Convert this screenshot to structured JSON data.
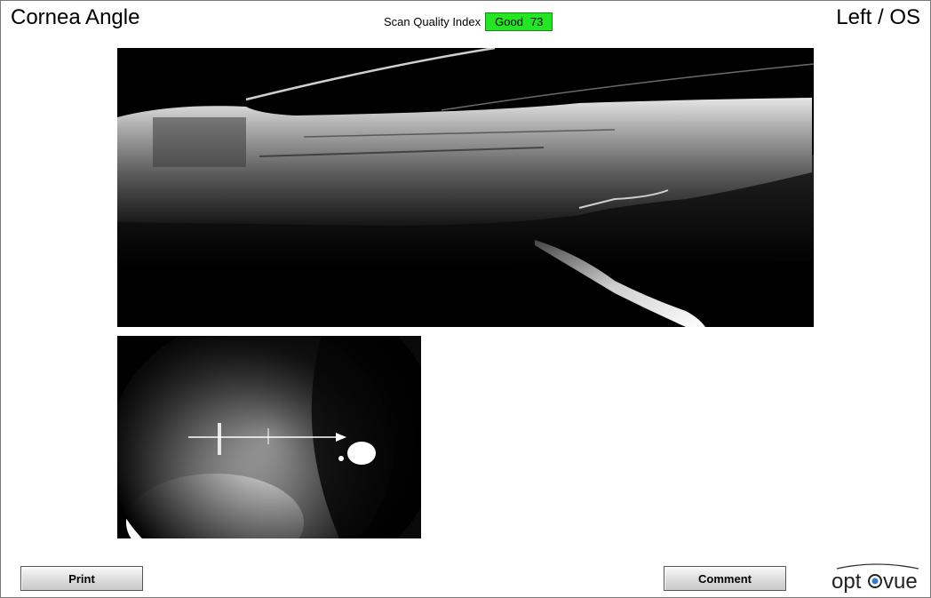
{
  "header": {
    "title": "Cornea Angle",
    "eye": "Left / OS",
    "scan_quality_label": "Scan Quality Index",
    "scan_quality_status": "Good",
    "scan_quality_value": "73",
    "scan_quality_color": "#22e622"
  },
  "images": {
    "bscan": "oct-cross-section-image",
    "fundus": "iris-camera-image"
  },
  "buttons": {
    "print_label": "Print",
    "comment_label": "Comment"
  },
  "logo": {
    "text": "optovue",
    "eye_color": "#2a7fd4"
  }
}
